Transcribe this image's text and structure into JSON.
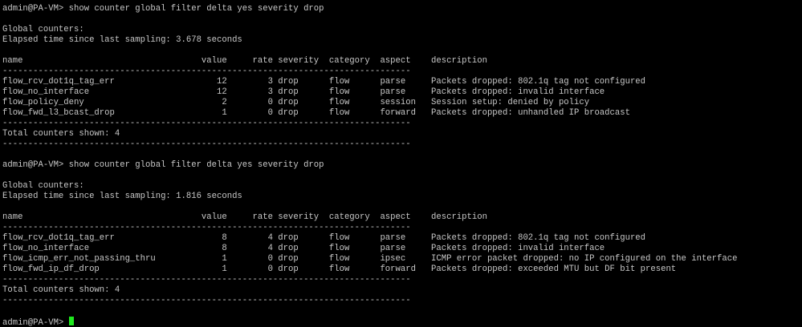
{
  "terminal": {
    "prompt": "admin@PA-VM> ",
    "cursor_color": "#1ee81e",
    "lines": [
      "admin@PA-VM> show counter global filter delta yes severity drop",
      "",
      "Global counters:",
      "Elapsed time since last sampling: 3.678 seconds",
      "",
      "name                                   value     rate severity  category  aspect    description",
      "--------------------------------------------------------------------------------",
      "flow_rcv_dot1q_tag_err                    12        3 drop      flow      parse     Packets dropped: 802.1q tag not configured",
      "flow_no_interface                         12        3 drop      flow      parse     Packets dropped: invalid interface",
      "flow_policy_deny                           2        0 drop      flow      session   Session setup: denied by policy",
      "flow_fwd_l3_bcast_drop                     1        0 drop      flow      forward   Packets dropped: unhandled IP broadcast",
      "--------------------------------------------------------------------------------",
      "Total counters shown: 4",
      "--------------------------------------------------------------------------------",
      "",
      "admin@PA-VM> show counter global filter delta yes severity drop",
      "",
      "Global counters:",
      "Elapsed time since last sampling: 1.816 seconds",
      "",
      "name                                   value     rate severity  category  aspect    description",
      "--------------------------------------------------------------------------------",
      "flow_rcv_dot1q_tag_err                     8        4 drop      flow      parse     Packets dropped: 802.1q tag not configured",
      "flow_no_interface                          8        4 drop      flow      parse     Packets dropped: invalid interface",
      "flow_icmp_err_not_passing_thru             1        0 drop      flow      ipsec     ICMP error packet dropped: no IP configured on the interface",
      "flow_fwd_ip_df_drop                        1        0 drop      flow      forward   Packets dropped: exceeded MTU but DF bit present",
      "--------------------------------------------------------------------------------",
      "Total counters shown: 4",
      "--------------------------------------------------------------------------------",
      ""
    ]
  }
}
